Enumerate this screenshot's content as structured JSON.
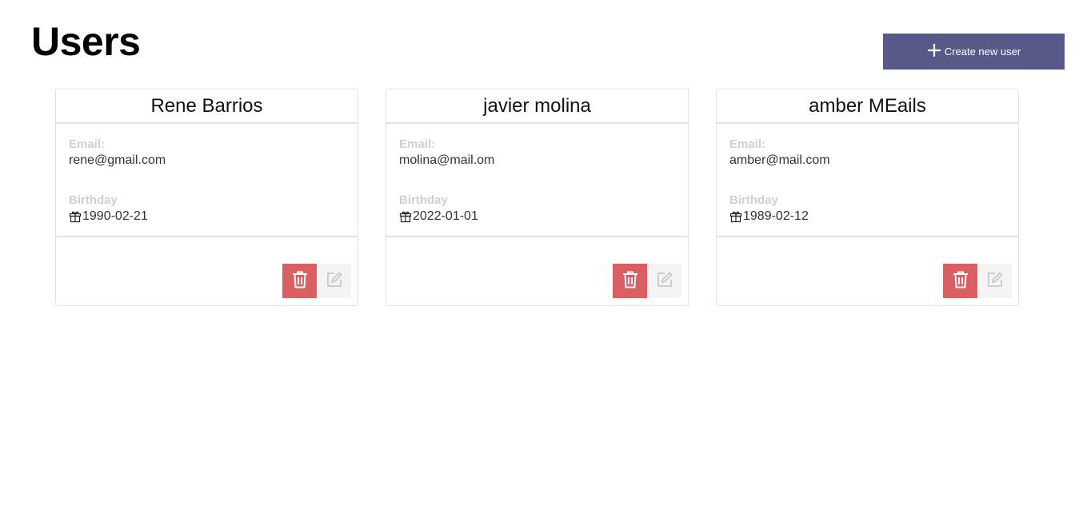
{
  "header": {
    "title": "Users",
    "create_button_label": "Create new user"
  },
  "labels": {
    "email": "Email:",
    "birthday": "Birthday"
  },
  "users": [
    {
      "name": "Rene Barrios",
      "email": "rene@gmail.com",
      "birthday": "1990-02-21"
    },
    {
      "name": "javier molina",
      "email": "molina@mail.om",
      "birthday": "2022-01-01"
    },
    {
      "name": "amber MEails",
      "email": "amber@mail.com",
      "birthday": "1989-02-12"
    }
  ],
  "colors": {
    "accent": "#575a89",
    "danger": "#d95f62",
    "muted_label": "#d0d0d0"
  },
  "icons": {
    "create": "plus-icon",
    "birthday": "gift-icon",
    "delete": "trash-icon",
    "edit": "edit-icon"
  }
}
